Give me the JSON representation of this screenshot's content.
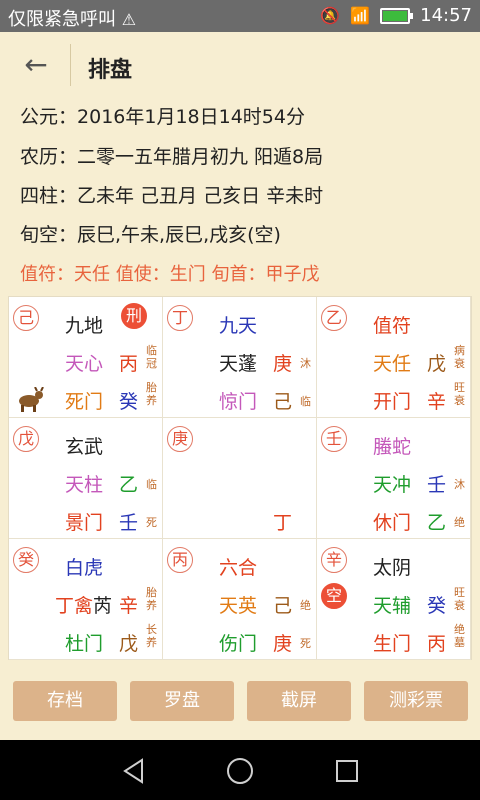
{
  "status": {
    "carrier_text": "仅限紧急呼叫",
    "time": "14:57",
    "battery_level": 0.9
  },
  "header": {
    "title": "排盘"
  },
  "info": {
    "gongyuan_label": "公元：",
    "gongyuan_value": "2016年1月18日14时54分",
    "nongli_label": "农历：",
    "nongli_value": "二零一五年腊月初九   阳遁8局",
    "sizhu_label": "四柱：",
    "sizhu_value": "乙未年 己丑月 己亥日 辛未时",
    "xunkong_label": "旬空：",
    "xunkong_value": "辰巳,午未,辰巳,戌亥(空)",
    "line5": "值符：天任  值使：生门  旬首：甲子戊"
  },
  "grid": {
    "c1": {
      "gan": "己",
      "badge": "刑",
      "deity": "九地",
      "star": "天心",
      "star_gan": "丙",
      "star_s1": "临",
      "star_s2": "冠",
      "door": "死门",
      "door_gan": "癸",
      "door_s1": "胎",
      "door_s2": "养"
    },
    "c2": {
      "gan": "丁",
      "deity": "九天",
      "star": "天蓬",
      "star_gan": "庚",
      "star_s1": "沐",
      "door": "惊门",
      "door_gan": "己",
      "door_s1": "临"
    },
    "c3": {
      "gan": "乙",
      "deity": "值符",
      "star": "天任",
      "star_gan": "戊",
      "star_s1": "病",
      "star_s2": "衰",
      "door": "开门",
      "door_gan": "辛",
      "door_s1": "旺",
      "door_s2": "衰"
    },
    "c4": {
      "gan": "戊",
      "deity": "玄武",
      "star": "天柱",
      "star_gan": "乙",
      "star_s1": "临",
      "door": "景门",
      "door_gan": "壬",
      "door_s1": "死"
    },
    "c5": {
      "gan": "庚",
      "bottom_gan": "丁"
    },
    "c6": {
      "gan": "壬",
      "deity": "螣蛇",
      "star": "天冲",
      "star_gan": "壬",
      "star_s1": "沐",
      "door": "休门",
      "door_gan": "乙",
      "door_s1": "绝"
    },
    "c7": {
      "gan": "癸",
      "deity": "白虎",
      "star_a": "丁",
      "star_b": "禽",
      "star_c": "芮",
      "star_gan": "辛",
      "star_s1": "胎",
      "star_s2": "养",
      "door": "杜门",
      "door_gan": "戊",
      "door_s1": "长",
      "door_s2": "养"
    },
    "c8": {
      "gan": "丙",
      "deity": "六合",
      "star": "天英",
      "star_gan": "己",
      "star_s1": "绝",
      "door": "伤门",
      "door_gan": "庚",
      "door_s1": "死"
    },
    "c9": {
      "gan": "辛",
      "badge": "空",
      "deity": "太阴",
      "star": "天辅",
      "star_gan": "癸",
      "star_s1": "旺",
      "star_s2": "衰",
      "door": "生门",
      "door_gan": "丙",
      "door_s1": "绝",
      "door_s2": "墓"
    }
  },
  "buttons": {
    "save": "存档",
    "compass": "罗盘",
    "screenshot": "截屏",
    "lottery": "测彩票"
  },
  "colors": {
    "background": "#f7eed2",
    "accent_red": "#ec4f36",
    "button": "#dcb38a"
  },
  "icons": [
    "back-arrow-icon",
    "goat-icon",
    "wifi-icon",
    "mute-icon",
    "battery-icon"
  ]
}
